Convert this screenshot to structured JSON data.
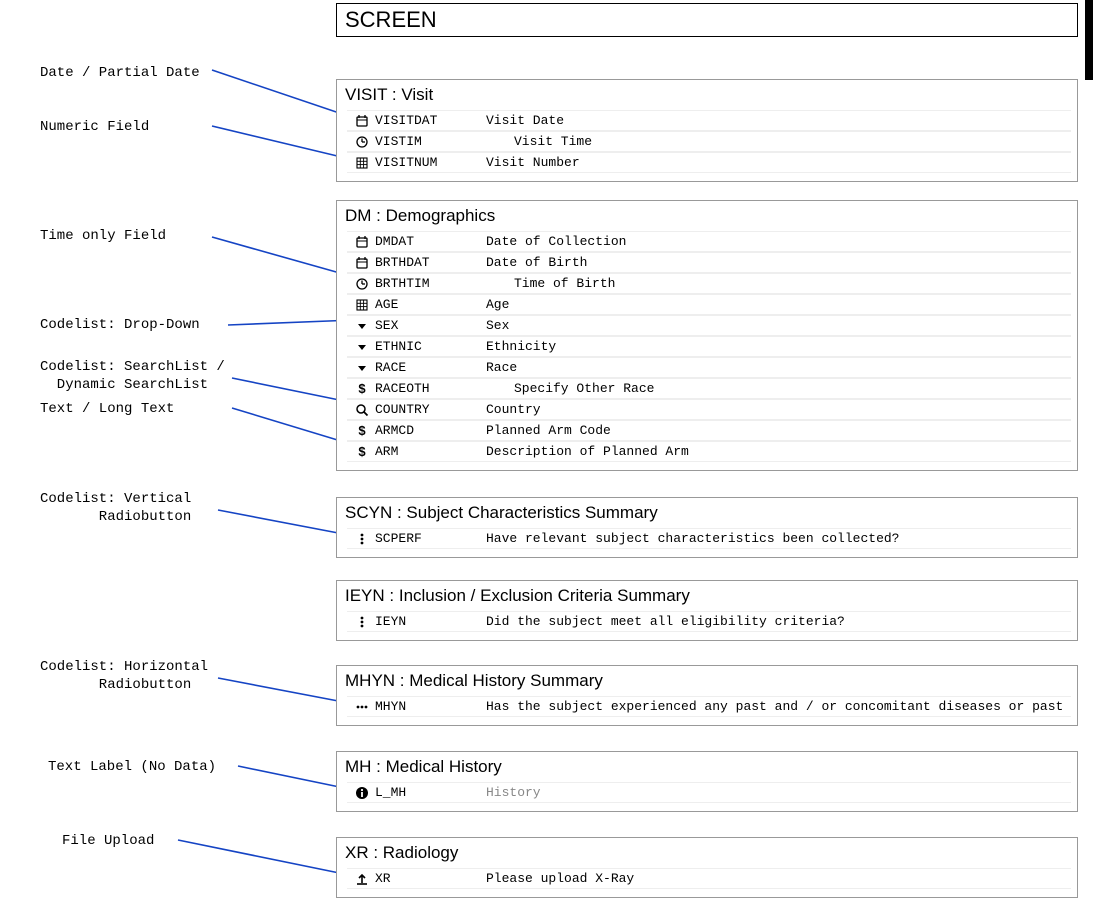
{
  "screen_title": "SCREEN",
  "annotations": {
    "date_partial": "Date / Partial Date",
    "numeric": "Numeric Field",
    "time_only": "Time only Field",
    "codelist_dropdown": "Codelist: Drop-Down",
    "codelist_searchlist_l1": "Codelist: SearchList /",
    "codelist_searchlist_l2": "  Dynamic SearchList",
    "text_longtext": "Text / Long Text",
    "codelist_vradio_l1": "Codelist: Vertical",
    "codelist_vradio_l2": "       Radiobutton",
    "codelist_hradio_l1": "Codelist: Horizontal",
    "codelist_hradio_l2": "       Radiobutton",
    "text_label": "Text Label (No Data)",
    "file_upload": "File Upload"
  },
  "forms": {
    "visit": {
      "header": "VISIT : Visit",
      "fields": [
        {
          "icon": "calendar",
          "code": "VISITDAT",
          "desc": "Visit Date"
        },
        {
          "icon": "clock",
          "code": "VISTIM",
          "desc": "Visit Time",
          "indent": true
        },
        {
          "icon": "grid",
          "code": "VISITNUM",
          "desc": "Visit Number"
        }
      ]
    },
    "dm": {
      "header": "DM : Demographics",
      "fields": [
        {
          "icon": "calendar",
          "code": "DMDAT",
          "desc": "Date of Collection"
        },
        {
          "icon": "calendar",
          "code": "BRTHDAT",
          "desc": "Date of Birth"
        },
        {
          "icon": "clock",
          "code": "BRTHTIM",
          "desc": "Time of Birth",
          "indent": true
        },
        {
          "icon": "grid",
          "code": "AGE",
          "desc": "Age"
        },
        {
          "icon": "caret",
          "code": "SEX",
          "desc": "Sex"
        },
        {
          "icon": "caret",
          "code": "ETHNIC",
          "desc": "Ethnicity"
        },
        {
          "icon": "caret",
          "code": "RACE",
          "desc": "Race"
        },
        {
          "icon": "text",
          "code": "RACEOTH",
          "desc": "Specify Other Race",
          "indent": true
        },
        {
          "icon": "search",
          "code": "COUNTRY",
          "desc": "Country"
        },
        {
          "icon": "text",
          "code": "ARMCD",
          "desc": "Planned Arm Code"
        },
        {
          "icon": "text",
          "code": "ARM",
          "desc": "Description of Planned Arm"
        }
      ]
    },
    "scyn": {
      "header": "SCYN : Subject Characteristics Summary",
      "fields": [
        {
          "icon": "vdots",
          "code": "SCPERF",
          "desc": "Have relevant subject characteristics been collected?"
        }
      ]
    },
    "ieyn": {
      "header": "IEYN : Inclusion / Exclusion Criteria Summary",
      "fields": [
        {
          "icon": "vdots",
          "code": "IEYN",
          "desc": "Did the subject meet all eligibility criteria?"
        }
      ]
    },
    "mhyn": {
      "header": "MHYN : Medical History Summary",
      "fields": [
        {
          "icon": "hdots",
          "code": "MHYN",
          "desc": "Has the subject experienced any past and / or concomitant diseases or past surge"
        }
      ]
    },
    "mh": {
      "header": "MH : Medical History",
      "fields": [
        {
          "icon": "info",
          "code": "L_MH",
          "desc": "History",
          "grey": true
        }
      ]
    },
    "xr": {
      "header": "XR : Radiology",
      "fields": [
        {
          "icon": "upload",
          "code": "XR",
          "desc": "Please upload X-Ray"
        }
      ]
    }
  }
}
